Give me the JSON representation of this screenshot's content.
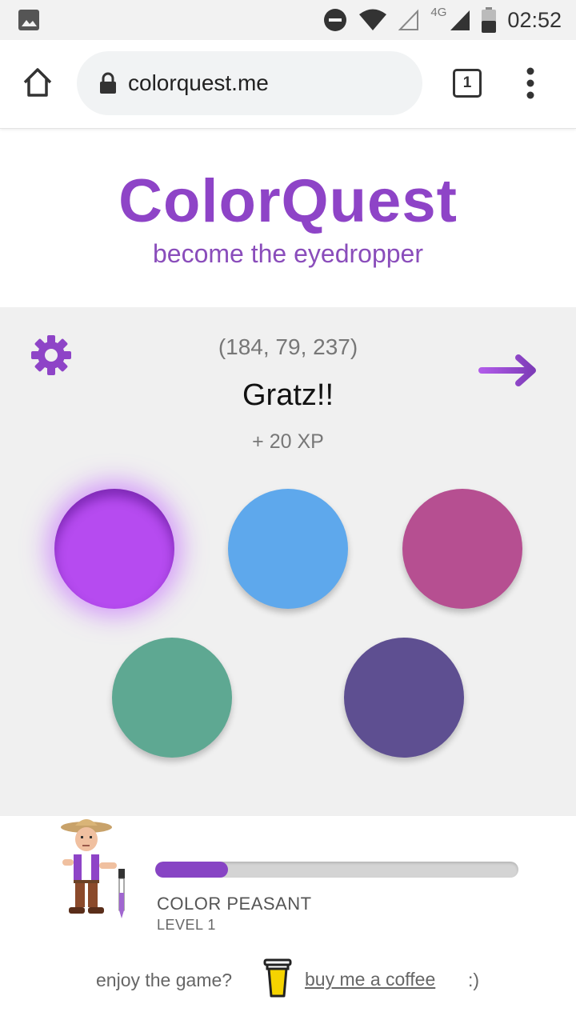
{
  "status_bar": {
    "network": "4G",
    "time": "02:52"
  },
  "browser": {
    "url": "colorquest.me",
    "tab_count": "1"
  },
  "header": {
    "title": "ColorQuest",
    "subtitle": "become the eyedropper"
  },
  "game": {
    "target_rgb": "(184, 79, 237)",
    "message": "Gratz!!",
    "xp_gain": "+ 20 XP",
    "options": [
      {
        "color": "#b64bf0",
        "selected": true
      },
      {
        "color": "#5ea8ec",
        "selected": false
      },
      {
        "color": "#b64f91",
        "selected": false
      },
      {
        "color": "#5ea892",
        "selected": false
      },
      {
        "color": "#5e4f91",
        "selected": false
      }
    ]
  },
  "player": {
    "rank": "COLOR PEASANT",
    "level": "LEVEL 1",
    "xp_progress": 0.2
  },
  "footer": {
    "enjoy_text": "enjoy the game?",
    "link_text": "buy me a coffee",
    "smile": ":)"
  },
  "colors": {
    "brand_purple": "#8e44c7",
    "progress_fill": "#8744c4",
    "panel_bg": "#f0f0f0"
  },
  "icons": [
    "image-icon",
    "dnd-icon",
    "wifi-icon",
    "signal-icon",
    "battery-icon",
    "home-icon",
    "lock-icon",
    "kebab-menu-icon",
    "gear-icon",
    "arrow-right-icon",
    "coffee-cup-icon"
  ]
}
